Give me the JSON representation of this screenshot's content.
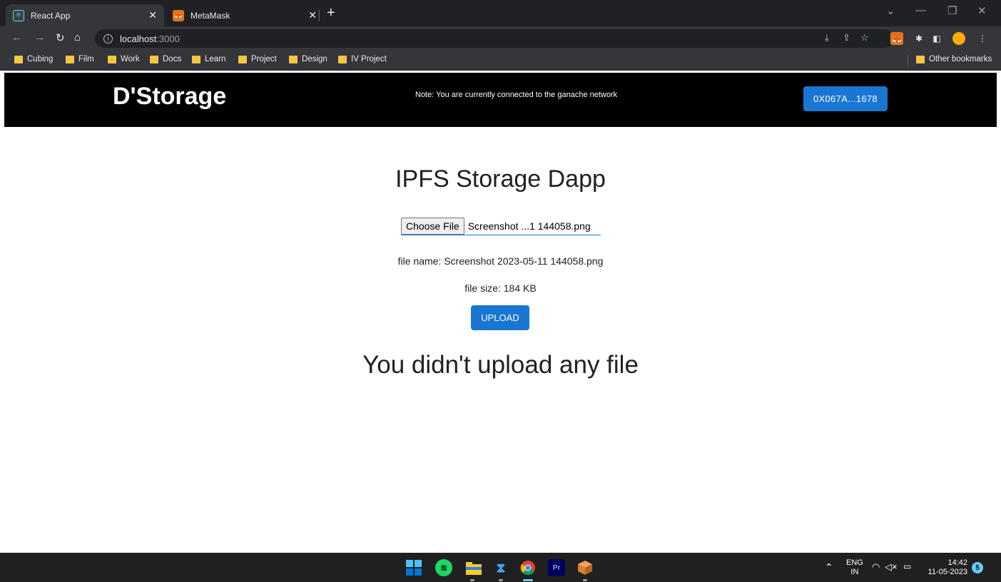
{
  "browser": {
    "tabs": [
      {
        "title": "React App",
        "favicon": "react-icon",
        "active": true
      },
      {
        "title": "MetaMask",
        "favicon": "metamask-fox-icon",
        "active": false
      }
    ],
    "address": {
      "host": "localhost",
      "port": ":3000"
    },
    "bookmarks": [
      "Cubing",
      "Film",
      "Work",
      "Docs",
      "Learn",
      "Project",
      "Design",
      "IV Project"
    ],
    "other_bookmarks": "Other bookmarks"
  },
  "app": {
    "brand": "D'Storage",
    "network_note": "Note: You are currently connected to the ganache network",
    "account": "0X067A...1678",
    "title": "IPFS Storage Dapp",
    "file_input": {
      "button": "Choose File",
      "chosen": "Screenshot ...1 144058.png"
    },
    "file_name": "file name: Screenshot 2023-05-11 144058.png",
    "file_size": "file size: 184 KB",
    "upload": "UPLOAD",
    "empty_message": "You didn't upload any file"
  },
  "taskbar": {
    "apps": [
      "windows-start-icon",
      "spotify-icon",
      "file-explorer-icon",
      "vscode-icon",
      "chrome-icon",
      "premiere-pro-icon",
      "package-icon"
    ],
    "premiere_label": "Pr",
    "lang": "ENG",
    "region": "IN",
    "time": "14:42",
    "date": "11-05-2023",
    "notifications": "5"
  },
  "colors": {
    "accent": "#1976d2",
    "navbar": "#000000",
    "chrome_dark": "#202124",
    "chrome_toolbar": "#35363a"
  }
}
